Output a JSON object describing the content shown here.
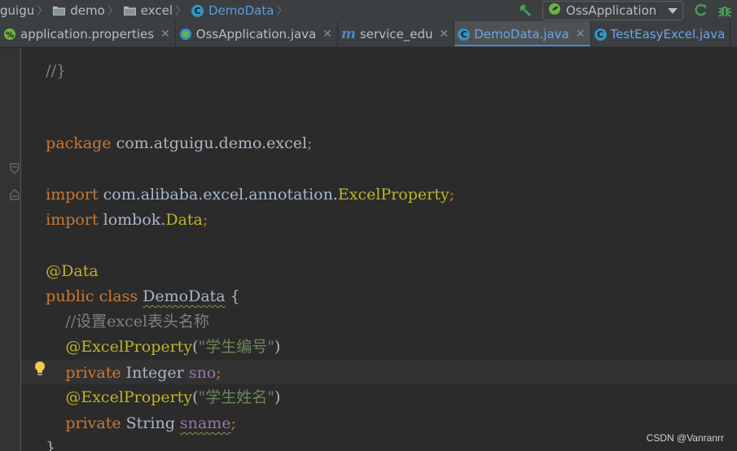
{
  "breadcrumb": {
    "items": [
      {
        "label": "guigu",
        "icon": "none"
      },
      {
        "label": "demo",
        "icon": "folder-icon"
      },
      {
        "label": "excel",
        "icon": "folder-icon"
      },
      {
        "label": "DemoData",
        "icon": "class-icon"
      }
    ]
  },
  "toolbar": {
    "run_config": "OssApplication",
    "icons": [
      "build-hammer-icon",
      "spring-boot-icon",
      "chevron-down-icon",
      "rerun-icon",
      "debug-bug-icon"
    ]
  },
  "tabs": [
    {
      "label": "application.properties",
      "icon": "spring-properties-icon",
      "active": false
    },
    {
      "label": "OssApplication.java",
      "icon": "spring-boot-icon",
      "active": false
    },
    {
      "label": "service_edu",
      "icon": "maven-m-icon",
      "active": false
    },
    {
      "label": "DemoData.java",
      "icon": "class-icon",
      "active": true
    },
    {
      "label": "TestEasyExcel.java",
      "icon": "class-icon",
      "active": false
    }
  ],
  "code": {
    "partial_top": "//}",
    "package_kw": "package",
    "package_name": " com.atguigu.demo.excel",
    "semicolon": ";",
    "import_kw": "import",
    "import1_pkg": " com.alibaba.excel.annotation.",
    "import1_cls": "ExcelProperty",
    "import2_pkg": " lombok.",
    "import2_cls": "Data",
    "data_ann": "@Data",
    "public_kw": "public class",
    "class_name": "DemoData",
    "open_brace": " {",
    "comment": "    //设置excel表头名称",
    "prop_ann": "@ExcelProperty",
    "open_paren": "(",
    "str1": "\"学生编号\"",
    "close_paren": ")",
    "private_kw": "private",
    "integer_type": " Integer ",
    "field1": "sno",
    "str2": "\"学生姓名\"",
    "string_type": " String ",
    "field2": "sname",
    "close_brace": "}"
  },
  "watermark": "CSDN @Vanranrr",
  "colors": {
    "keyword": "#cc7832",
    "annotation": "#bbb529",
    "string": "#6a8759",
    "comment": "#808080",
    "field": "#9876aa",
    "plain": "#a9b7c6",
    "background": "#2b2b2b",
    "active_tab_underline": "#4a88c7"
  }
}
